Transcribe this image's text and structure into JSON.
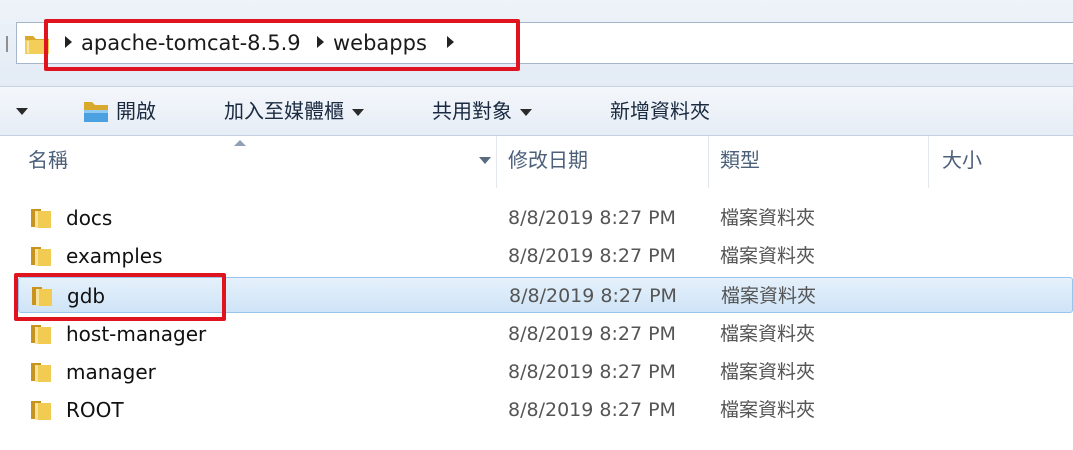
{
  "breadcrumb": {
    "segments": [
      "apache-tomcat-8.5.9",
      "webapps"
    ]
  },
  "toolbar": {
    "open_label": "開啟",
    "library_label": "加入至媒體櫃",
    "share_label": "共用對象",
    "new_folder_label": "新增資料夾"
  },
  "columns": {
    "name": "名稱",
    "modified": "修改日期",
    "type": "類型",
    "size": "大小"
  },
  "files": [
    {
      "name": "docs",
      "modified": "8/8/2019 8:27 PM",
      "type": "檔案資料夾",
      "selected": false
    },
    {
      "name": "examples",
      "modified": "8/8/2019 8:27 PM",
      "type": "檔案資料夾",
      "selected": false
    },
    {
      "name": "gdb",
      "modified": "8/8/2019 8:27 PM",
      "type": "檔案資料夾",
      "selected": true
    },
    {
      "name": "host-manager",
      "modified": "8/8/2019 8:27 PM",
      "type": "檔案資料夾",
      "selected": false
    },
    {
      "name": "manager",
      "modified": "8/8/2019 8:27 PM",
      "type": "檔案資料夾",
      "selected": false
    },
    {
      "name": "ROOT",
      "modified": "8/8/2019 8:27 PM",
      "type": "檔案資料夾",
      "selected": false
    }
  ],
  "icons": {
    "folder": "folder-icon",
    "open": "open-folder-icon",
    "breadcrumb_separator": "chevron-right-icon",
    "dropdown": "chevron-down-icon"
  },
  "colors": {
    "highlight": "#e0141e",
    "selection": "#cfe4f7",
    "folder": "#e8c04a"
  }
}
